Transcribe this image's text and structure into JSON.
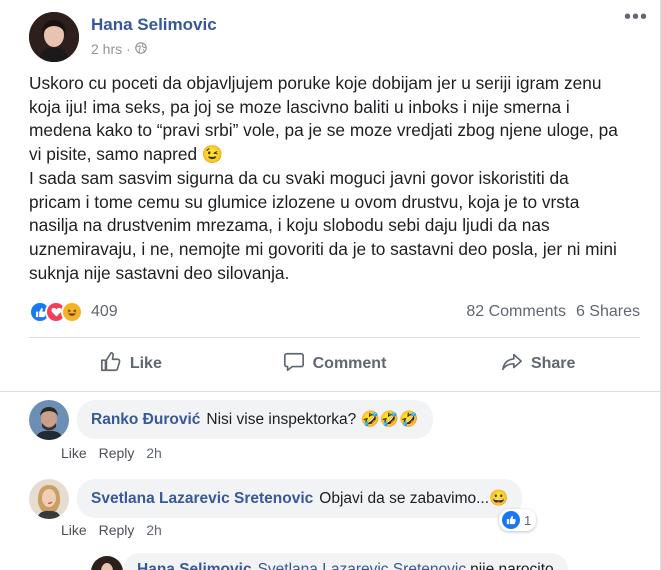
{
  "post": {
    "author": "Hana Selimovic",
    "time": "2 hrs",
    "separator": "·",
    "more": "•••",
    "paragraphs": [
      "Uskoro cu poceti da objavljujem poruke koje dobijam jer u seriji igram zenu koja iju! ima seks, pa joj se moze lascivno baliti u inboks i nije smerna i medena kako to “pravi srbi” vole, pa je se moze vredjati zbog njene uloge, pa vi pisite, samo napred 😉",
      "I sada sam sasvim sigurna da cu svaki moguci javni govor iskoristiti da pricam i tome cemu su glumice izlozene u ovom drustvu, koja je to vrsta nasilja na drustvenim mrezama, i koju slobodu sebi daju ljudi da nas uznemiravaju, i ne, nemojte mi govoriti da je to sastavni deo posla, jer ni mini suknja nije sastavni deo silovanja."
    ],
    "reaction_count": "409",
    "comments_count": "82 Comments",
    "shares_count": "6 Shares",
    "actions": {
      "like": "Like",
      "comment": "Comment",
      "share": "Share"
    }
  },
  "comments": [
    {
      "name": "Ranko Đurović",
      "text": "Nisi vise inspektorka? 🤣🤣🤣",
      "like": "Like",
      "reply": "Reply",
      "time": "2h"
    },
    {
      "name": "Svetlana Lazarevic Sretenovic",
      "text": "Objavi da se zabavimo...😀",
      "like": "Like",
      "reply": "Reply",
      "time": "2h",
      "likes": "1"
    },
    {
      "name": "Hana Selimovic",
      "mention": "Svetlana Lazarevic Sretenovic",
      "text": "nije narocito"
    }
  ],
  "colors": {
    "link": "#365899",
    "like_blue": "#1877f2",
    "love_red": "#f33e58",
    "haha_yellow": "#f7b125"
  }
}
